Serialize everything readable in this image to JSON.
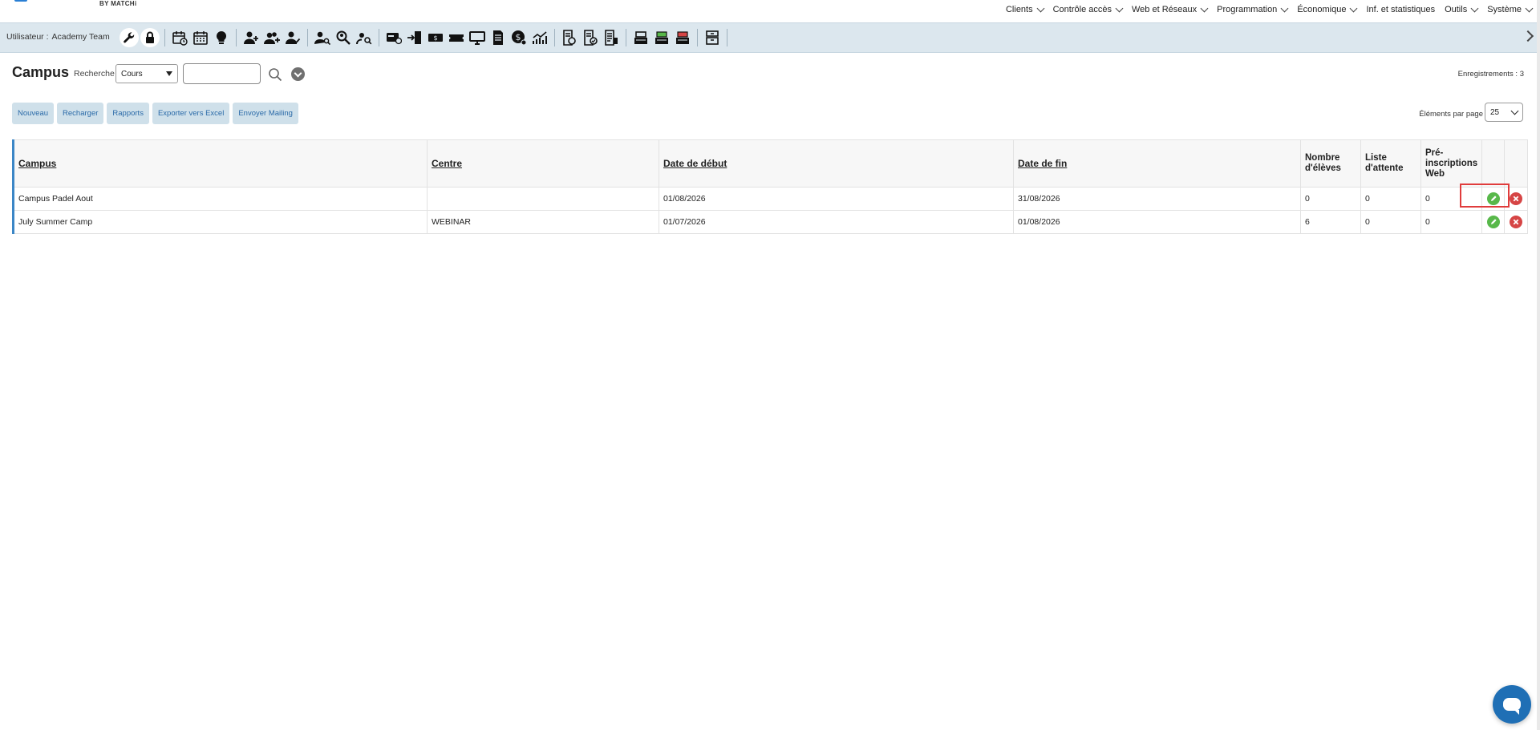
{
  "brand": {
    "sub": "BY MATCHi"
  },
  "topnav": {
    "items": [
      {
        "label": "Clients",
        "dropdown": true
      },
      {
        "label": "Contrôle accès",
        "dropdown": true
      },
      {
        "label": "Web et Réseaux",
        "dropdown": true
      },
      {
        "label": "Programmation",
        "dropdown": true
      },
      {
        "label": "Économique",
        "dropdown": true
      },
      {
        "label": "Inf. et statistiques",
        "dropdown": false
      },
      {
        "label": "Outils",
        "dropdown": true
      },
      {
        "label": "Système",
        "dropdown": true
      }
    ]
  },
  "toolbar": {
    "user_prefix": "Utilisateur :",
    "user_name": "Academy Team"
  },
  "page": {
    "title": "Campus",
    "search_label": "Recherche",
    "search_select_value": "Cours",
    "search_value": "",
    "records_text": "Enregistrements : 3"
  },
  "actions": {
    "new": "Nouveau",
    "reload": "Recharger",
    "reports": "Rapports",
    "export": "Exporter vers Excel",
    "mailing": "Envoyer Mailing"
  },
  "per_page": {
    "label": "Éléments par page",
    "value": "25"
  },
  "table": {
    "headers": {
      "campus": "Campus",
      "centre": "Centre",
      "start": "Date de début",
      "end": "Date de fin",
      "students": "Nombre d'élèves",
      "waitlist": "Liste d'attente",
      "prereg": "Pré-inscriptions Web"
    },
    "rows": [
      {
        "campus": "Campus Padel Aout",
        "centre": "",
        "start": "01/08/2026",
        "end": "31/08/2026",
        "students": "0",
        "waitlist": "0",
        "prereg": "0"
      },
      {
        "campus": "July Summer Camp",
        "centre": "WEBINAR",
        "start": "01/07/2026",
        "end": "01/08/2026",
        "students": "6",
        "waitlist": "0",
        "prereg": "0"
      }
    ]
  },
  "colors": {
    "accent": "#3b86c6",
    "toolbar_bg": "#dce7ee",
    "button_bg": "#cfe0ea",
    "edit": "#58b84a",
    "delete": "#d64545",
    "highlight": "#e03c3c"
  }
}
